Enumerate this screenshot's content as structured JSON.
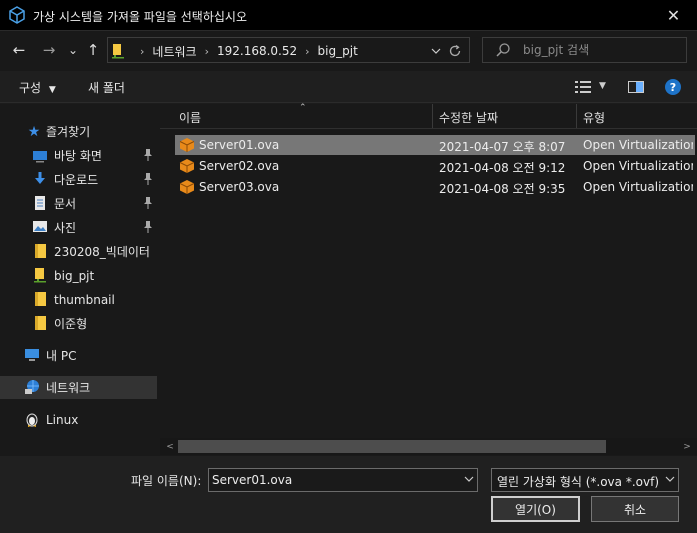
{
  "window": {
    "title": "가상 시스템을 가져올 파일을 선택하십시오",
    "close_glyph": "✕"
  },
  "nav": {
    "back_glyph": "←",
    "forward_glyph": "→",
    "recent_glyph": "⌄",
    "up_glyph": "↑",
    "breadcrumb": [
      "네트워크",
      "192.168.0.52",
      "big_pjt"
    ],
    "search_placeholder": "big_pjt 검색"
  },
  "toolbar": {
    "organize_label": "구성",
    "new_folder_label": "새 폴더"
  },
  "sidebar": {
    "items": [
      {
        "label": "즐겨찾기",
        "icon": "star-icon",
        "pinned": false
      },
      {
        "label": "바탕 화면",
        "icon": "desktop-icon",
        "pinned": true
      },
      {
        "label": "다운로드",
        "icon": "download-icon",
        "pinned": true
      },
      {
        "label": "문서",
        "icon": "document-icon",
        "pinned": true
      },
      {
        "label": "사진",
        "icon": "pictures-icon",
        "pinned": true
      },
      {
        "label": "230208_빅데이터",
        "icon": "folder-icon",
        "pinned": false
      },
      {
        "label": "big_pjt",
        "icon": "network-folder-icon",
        "pinned": false
      },
      {
        "label": "thumbnail",
        "icon": "folder-icon",
        "pinned": false
      },
      {
        "label": "이준형",
        "icon": "folder-icon",
        "pinned": false
      },
      {
        "label": "내 PC",
        "icon": "pc-icon",
        "pinned": false
      },
      {
        "label": "네트워크",
        "icon": "network-icon",
        "pinned": false
      },
      {
        "label": "Linux",
        "icon": "linux-icon",
        "pinned": false
      }
    ],
    "selected": "네트워크"
  },
  "columns": {
    "name": "이름",
    "modified": "수정한 날짜",
    "type": "유형"
  },
  "files": [
    {
      "name": "Server01.ova",
      "modified": "2021-04-07 오후 8:07",
      "type": "Open Virtualization Format Archive",
      "selected": true
    },
    {
      "name": "Server02.ova",
      "modified": "2021-04-08 오전 9:12",
      "type": "Open Virtualization Format Archive",
      "selected": false
    },
    {
      "name": "Server03.ova",
      "modified": "2021-04-08 오전 9:35",
      "type": "Open Virtualization Format Archive",
      "selected": false
    }
  ],
  "footer": {
    "filename_label": "파일 이름(N):",
    "filename_value": "Server01.ova",
    "filetype_value": "열린 가상화 형식 (*.ova *.ovf)",
    "open_label": "열기(O)",
    "cancel_label": "취소"
  },
  "colors": {
    "accent": "#1e90ff",
    "folder": "#f5c842",
    "ova_orange": "#e88a1a"
  }
}
